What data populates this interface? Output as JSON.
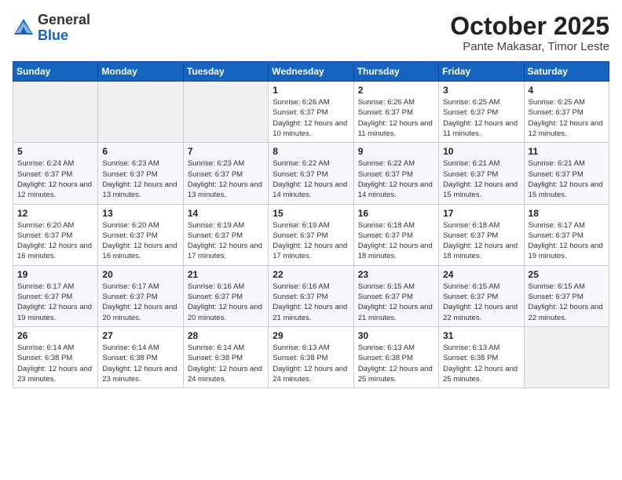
{
  "header": {
    "logo_general": "General",
    "logo_blue": "Blue",
    "month_title": "October 2025",
    "location": "Pante Makasar, Timor Leste"
  },
  "weekdays": [
    "Sunday",
    "Monday",
    "Tuesday",
    "Wednesday",
    "Thursday",
    "Friday",
    "Saturday"
  ],
  "weeks": [
    [
      {
        "day": "",
        "info": ""
      },
      {
        "day": "",
        "info": ""
      },
      {
        "day": "",
        "info": ""
      },
      {
        "day": "1",
        "info": "Sunrise: 6:26 AM\nSunset: 6:37 PM\nDaylight: 12 hours\nand 10 minutes."
      },
      {
        "day": "2",
        "info": "Sunrise: 6:26 AM\nSunset: 6:37 PM\nDaylight: 12 hours\nand 11 minutes."
      },
      {
        "day": "3",
        "info": "Sunrise: 6:25 AM\nSunset: 6:37 PM\nDaylight: 12 hours\nand 11 minutes."
      },
      {
        "day": "4",
        "info": "Sunrise: 6:25 AM\nSunset: 6:37 PM\nDaylight: 12 hours\nand 12 minutes."
      }
    ],
    [
      {
        "day": "5",
        "info": "Sunrise: 6:24 AM\nSunset: 6:37 PM\nDaylight: 12 hours\nand 12 minutes."
      },
      {
        "day": "6",
        "info": "Sunrise: 6:23 AM\nSunset: 6:37 PM\nDaylight: 12 hours\nand 13 minutes."
      },
      {
        "day": "7",
        "info": "Sunrise: 6:23 AM\nSunset: 6:37 PM\nDaylight: 12 hours\nand 13 minutes."
      },
      {
        "day": "8",
        "info": "Sunrise: 6:22 AM\nSunset: 6:37 PM\nDaylight: 12 hours\nand 14 minutes."
      },
      {
        "day": "9",
        "info": "Sunrise: 6:22 AM\nSunset: 6:37 PM\nDaylight: 12 hours\nand 14 minutes."
      },
      {
        "day": "10",
        "info": "Sunrise: 6:21 AM\nSunset: 6:37 PM\nDaylight: 12 hours\nand 15 minutes."
      },
      {
        "day": "11",
        "info": "Sunrise: 6:21 AM\nSunset: 6:37 PM\nDaylight: 12 hours\nand 15 minutes."
      }
    ],
    [
      {
        "day": "12",
        "info": "Sunrise: 6:20 AM\nSunset: 6:37 PM\nDaylight: 12 hours\nand 16 minutes."
      },
      {
        "day": "13",
        "info": "Sunrise: 6:20 AM\nSunset: 6:37 PM\nDaylight: 12 hours\nand 16 minutes."
      },
      {
        "day": "14",
        "info": "Sunrise: 6:19 AM\nSunset: 6:37 PM\nDaylight: 12 hours\nand 17 minutes."
      },
      {
        "day": "15",
        "info": "Sunrise: 6:19 AM\nSunset: 6:37 PM\nDaylight: 12 hours\nand 17 minutes."
      },
      {
        "day": "16",
        "info": "Sunrise: 6:18 AM\nSunset: 6:37 PM\nDaylight: 12 hours\nand 18 minutes."
      },
      {
        "day": "17",
        "info": "Sunrise: 6:18 AM\nSunset: 6:37 PM\nDaylight: 12 hours\nand 18 minutes."
      },
      {
        "day": "18",
        "info": "Sunrise: 6:17 AM\nSunset: 6:37 PM\nDaylight: 12 hours\nand 19 minutes."
      }
    ],
    [
      {
        "day": "19",
        "info": "Sunrise: 6:17 AM\nSunset: 6:37 PM\nDaylight: 12 hours\nand 19 minutes."
      },
      {
        "day": "20",
        "info": "Sunrise: 6:17 AM\nSunset: 6:37 PM\nDaylight: 12 hours\nand 20 minutes."
      },
      {
        "day": "21",
        "info": "Sunrise: 6:16 AM\nSunset: 6:37 PM\nDaylight: 12 hours\nand 20 minutes."
      },
      {
        "day": "22",
        "info": "Sunrise: 6:16 AM\nSunset: 6:37 PM\nDaylight: 12 hours\nand 21 minutes."
      },
      {
        "day": "23",
        "info": "Sunrise: 6:15 AM\nSunset: 6:37 PM\nDaylight: 12 hours\nand 21 minutes."
      },
      {
        "day": "24",
        "info": "Sunrise: 6:15 AM\nSunset: 6:37 PM\nDaylight: 12 hours\nand 22 minutes."
      },
      {
        "day": "25",
        "info": "Sunrise: 6:15 AM\nSunset: 6:37 PM\nDaylight: 12 hours\nand 22 minutes."
      }
    ],
    [
      {
        "day": "26",
        "info": "Sunrise: 6:14 AM\nSunset: 6:38 PM\nDaylight: 12 hours\nand 23 minutes."
      },
      {
        "day": "27",
        "info": "Sunrise: 6:14 AM\nSunset: 6:38 PM\nDaylight: 12 hours\nand 23 minutes."
      },
      {
        "day": "28",
        "info": "Sunrise: 6:14 AM\nSunset: 6:38 PM\nDaylight: 12 hours\nand 24 minutes."
      },
      {
        "day": "29",
        "info": "Sunrise: 6:13 AM\nSunset: 6:38 PM\nDaylight: 12 hours\nand 24 minutes."
      },
      {
        "day": "30",
        "info": "Sunrise: 6:13 AM\nSunset: 6:38 PM\nDaylight: 12 hours\nand 25 minutes."
      },
      {
        "day": "31",
        "info": "Sunrise: 6:13 AM\nSunset: 6:38 PM\nDaylight: 12 hours\nand 25 minutes."
      },
      {
        "day": "",
        "info": ""
      }
    ]
  ]
}
